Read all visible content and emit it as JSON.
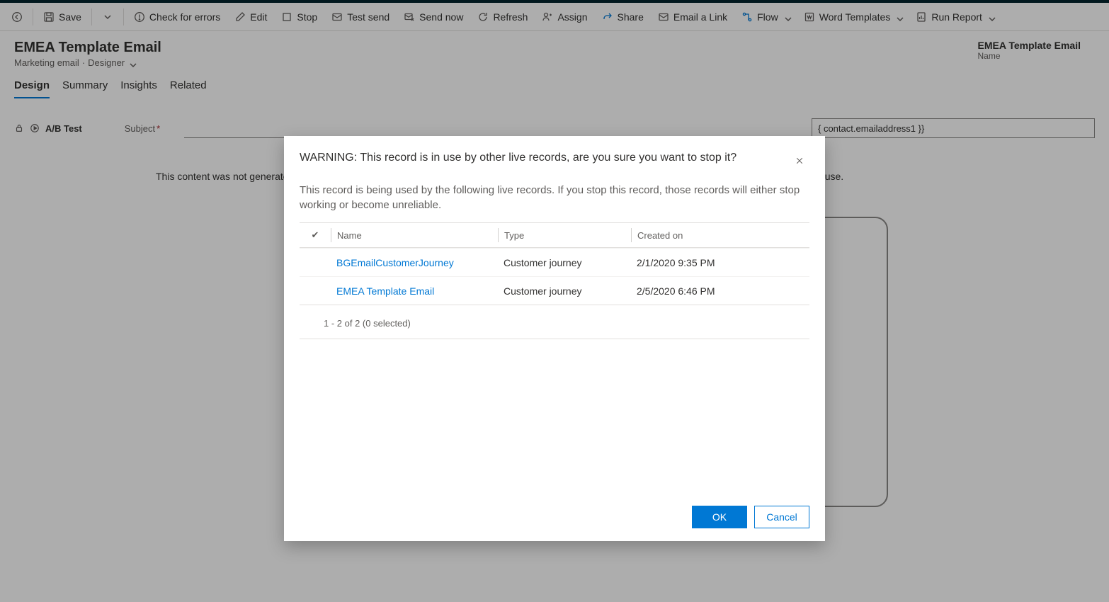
{
  "commandBar": {
    "save": "Save",
    "checkErrors": "Check for errors",
    "edit": "Edit",
    "stop": "Stop",
    "testSend": "Test send",
    "sendNow": "Send now",
    "refresh": "Refresh",
    "assign": "Assign",
    "share": "Share",
    "emailLink": "Email a Link",
    "flow": "Flow",
    "wordTemplates": "Word Templates",
    "runReport": "Run Report"
  },
  "header": {
    "title": "EMEA Template Email",
    "subtitle_entity": "Marketing email",
    "subtitle_form": "Designer",
    "right_title": "EMEA Template Email",
    "right_label": "Name"
  },
  "tabs": {
    "design": "Design",
    "summary": "Summary",
    "insights": "Insights",
    "related": "Related"
  },
  "form": {
    "abtest_label": "A/B Test",
    "subject_label": "Subject",
    "token_value": "{ contact.emailaddress1 }}",
    "notice": "This content was not generated for this email. Recipients of your email may see content variations depending on which email client and screen size they use."
  },
  "modal": {
    "title": "WARNING: This record is in use by other live records, are you sure you want to stop it?",
    "description": "This record is being used by the following live records. If you stop this record, those records will either stop working or become unreliable.",
    "columns": {
      "check": "✔",
      "name": "Name",
      "type": "Type",
      "created": "Created on"
    },
    "rows": [
      {
        "name": "BGEmailCustomerJourney",
        "type": "Customer journey",
        "created": "2/1/2020 9:35 PM"
      },
      {
        "name": "EMEA Template Email",
        "type": "Customer journey",
        "created": "2/5/2020 6:46 PM"
      }
    ],
    "footer": "1 - 2 of 2 (0 selected)",
    "ok": "OK",
    "cancel": "Cancel"
  }
}
